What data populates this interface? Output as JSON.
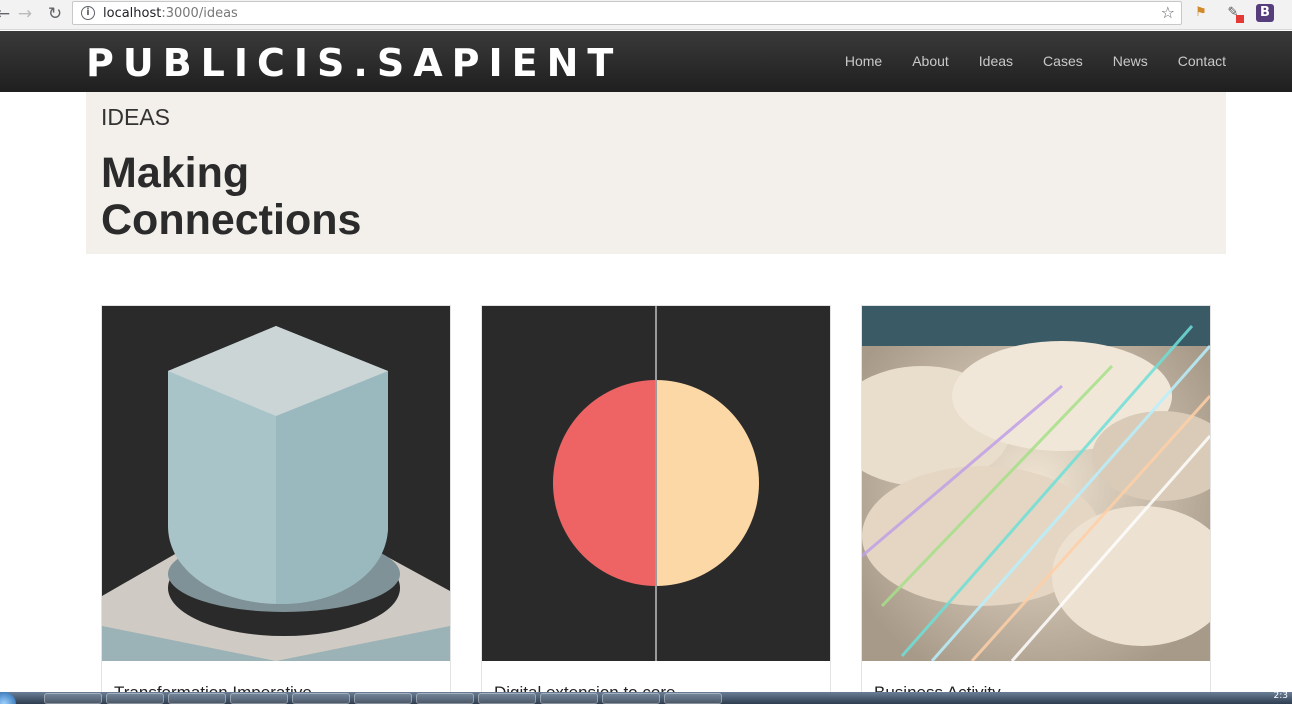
{
  "browser": {
    "url_host": "localhost",
    "url_path": ":3000/ideas"
  },
  "site": {
    "logo": "PUBLICIS.SAPIENT",
    "nav": [
      "Home",
      "About",
      "Ideas",
      "Cases",
      "News",
      "Contact"
    ]
  },
  "hero": {
    "kicker": "IDEAS",
    "title": "Making Connections"
  },
  "cards": [
    {
      "title": "Transformation Imperative",
      "image": "blue-cube-through-hole"
    },
    {
      "title": "Digital extension to core",
      "image": "split-circle-red-yellow"
    },
    {
      "title": "Business Activity",
      "image": "clouds-light-streaks"
    }
  ],
  "taskbar": {
    "clock": "2:3"
  },
  "colors": {
    "header_bg": "#2a2a2a",
    "hero_bg": "#f3f0eb",
    "circle_red": "#ee6464",
    "circle_yellow": "#fbd8a6",
    "cube_blue": "#a8c4c9"
  }
}
